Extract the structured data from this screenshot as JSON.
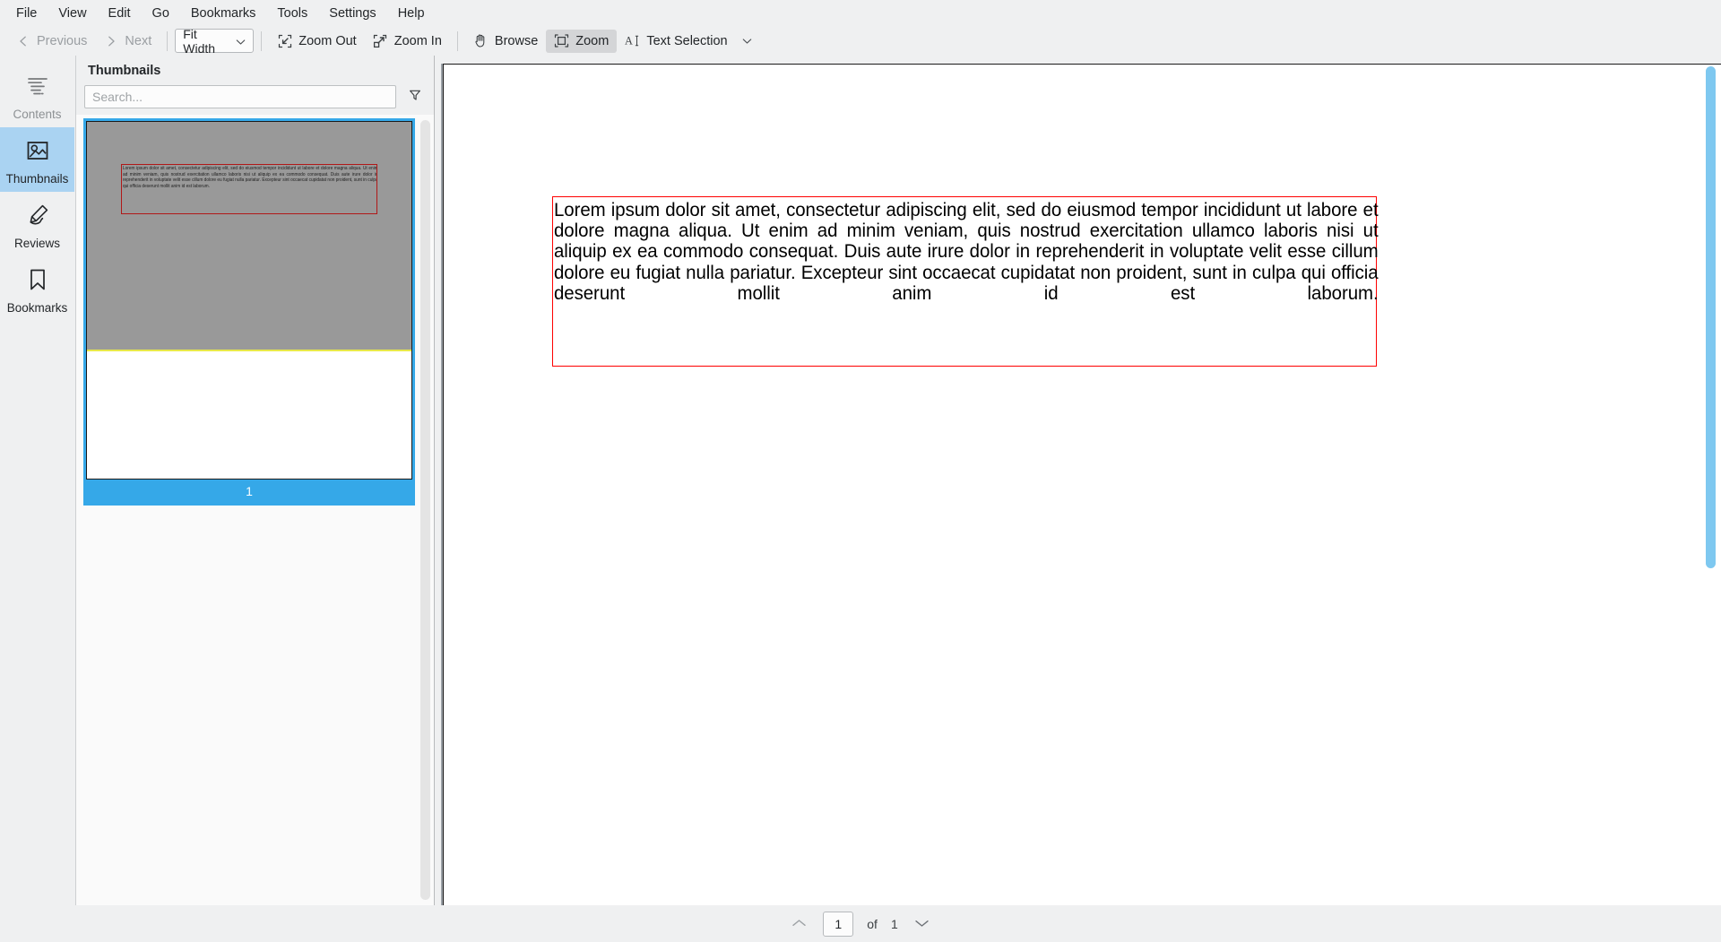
{
  "menu": {
    "items": [
      {
        "label": "File"
      },
      {
        "label": "View"
      },
      {
        "label": "Edit"
      },
      {
        "label": "Go"
      },
      {
        "label": "Bookmarks"
      },
      {
        "label": "Tools"
      },
      {
        "label": "Settings"
      },
      {
        "label": "Help"
      }
    ]
  },
  "toolbar": {
    "previous_label": "Previous",
    "next_label": "Next",
    "zoom_mode": "Fit Width",
    "zoom_out_label": "Zoom Out",
    "zoom_in_label": "Zoom In",
    "browse_label": "Browse",
    "zoom_label": "Zoom",
    "text_selection_label": "Text Selection",
    "active_tool": "Zoom"
  },
  "rail": {
    "items": [
      {
        "label": "Contents",
        "icon": "contents-icon",
        "selected": false,
        "muted": true
      },
      {
        "label": "Thumbnails",
        "icon": "thumbnails-icon",
        "selected": true,
        "muted": false
      },
      {
        "label": "Reviews",
        "icon": "reviews-icon",
        "selected": false,
        "muted": false
      },
      {
        "label": "Bookmarks",
        "icon": "bookmarks-icon",
        "selected": false,
        "muted": false
      }
    ]
  },
  "dock": {
    "title": "Thumbnails",
    "search_placeholder": "Search...",
    "search_value": "",
    "filter_icon": "filter-icon",
    "thumbnail": {
      "page_number": "1",
      "selected": true,
      "text": "Lorem ipsum dolor sit amet, consectetur adipiscing elit, sed do eiusmod tempor incididunt ut labore et dolore magna aliqua. Ut enim ad minim veniam, quis nostrud exercitation ullamco laboris nisi ut aliquip ex ea commodo consequat. Duis aute irure dolor in reprehenderit in voluptate velit esse cillum dolore eu fugiat nulla pariatur. Excepteur sint occaecat cupidatat non proident, sunt in culpa qui officia deserunt mollit anim id est laborum."
    }
  },
  "document": {
    "body_text": "Lorem ipsum dolor sit amet, consectetur adipiscing elit, sed do eiusmod tempor incididunt ut labore et dolore magna aliqua. Ut enim ad minim veniam, quis nostrud exercitation ullamco laboris nisi ut aliquip ex ea commodo consequat. Duis aute irure dolor in reprehenderit in voluptate velit esse cillum dolore eu fugiat nulla pariatur. Excepteur sint occaecat cupidatat non proident, sunt in culpa qui officia deserunt mollit anim id est laborum."
  },
  "status": {
    "current_page": "1",
    "of_label": "of",
    "total_pages": "1"
  },
  "colors": {
    "accent_blue": "#35a8e8",
    "selection_blue": "#aad3f2",
    "scrollbar_blue": "#7ec8f0",
    "annotation_red": "#fe0000",
    "thumb_annotation_red": "#b01818",
    "overlay_gray": "#999999",
    "overlay_yellow": "#e8e84a",
    "chrome_bg": "#eff0f1"
  }
}
